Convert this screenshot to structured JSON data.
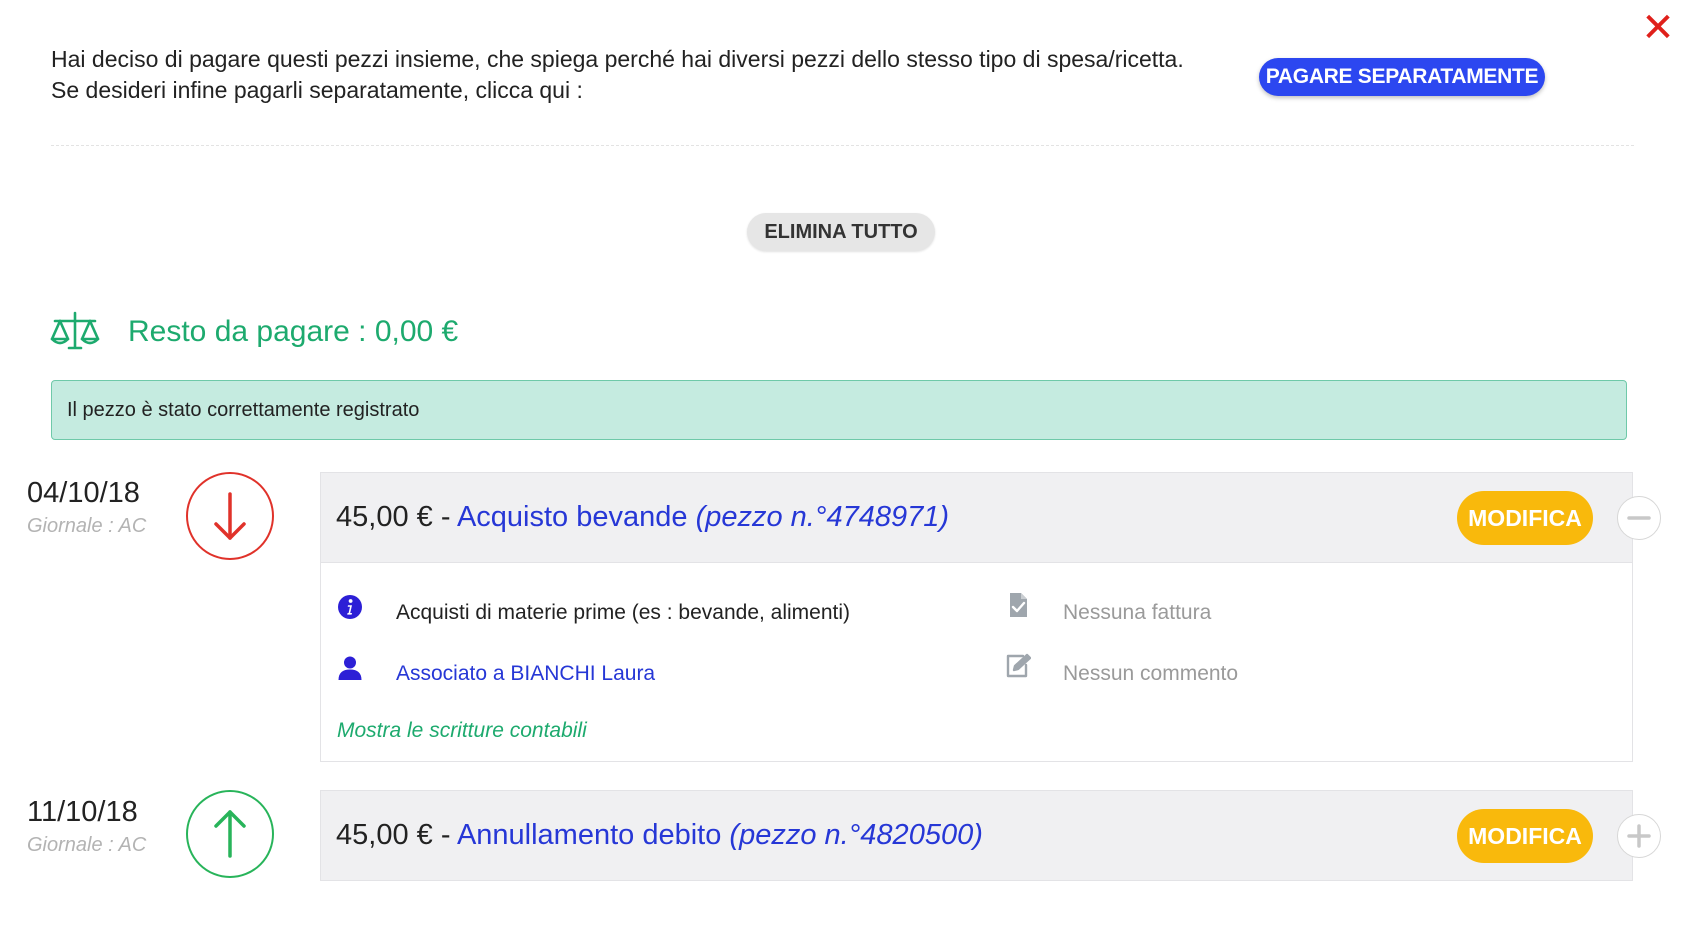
{
  "close": {
    "label": "✕"
  },
  "intro": {
    "line1": "Hai deciso di pagare questi pezzi insieme, che spiega perché hai diversi pezzi dello stesso tipo di spesa/ricetta.",
    "line2": "Se desideri infine pagarli separatamente, clicca qui :"
  },
  "buttons": {
    "pay_separately": "PAGARE SEPARATAMENTE",
    "delete_all": "ELIMINA TUTTO"
  },
  "balance": {
    "label": "Resto da pagare : 0,00 €",
    "icon": "balance-scale-icon"
  },
  "alert": {
    "message": "Il pezzo è stato correttamente registrato"
  },
  "entries": [
    {
      "date": "04/10/18",
      "journal": "Giornale : AC",
      "direction": "down",
      "amount": "45,00 €",
      "separator": " - ",
      "description": "Acquisto bevande",
      "reference": "(pezzo n.°4748971)",
      "modify_label": "MODIFICA",
      "toggle": "collapse",
      "details": {
        "category": "Acquisti di materie prime (es : bevande, alimenti)",
        "associated": "Associato a BIANCHI Laura",
        "invoice": "Nessuna fattura",
        "comment": "Nessun commento",
        "show_entries": "Mostra le scritture contabili"
      }
    },
    {
      "date": "11/10/18",
      "journal": "Giornale : AC",
      "direction": "up",
      "amount": "45,00 €",
      "separator": " - ",
      "description": "Annullamento debito",
      "reference": "(pezzo  n.°4820500)",
      "modify_label": "MODIFICA",
      "toggle": "expand"
    }
  ],
  "colors": {
    "primary_blue": "#2c47f0",
    "link_blue": "#2637d6",
    "green": "#1daa6e",
    "modify_yellow": "#f9b90c",
    "red": "#e0322a",
    "alert_bg": "#c5ebe0"
  }
}
